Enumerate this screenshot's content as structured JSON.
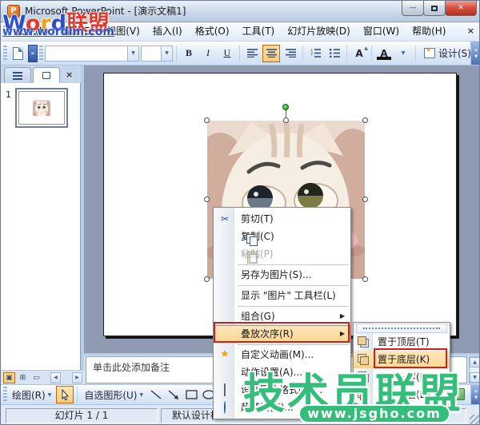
{
  "title_bar": {
    "title": "Microsoft PowerPoint - [演示文稿1]",
    "app_icon_letter": "P"
  },
  "menu_bar": {
    "items": [
      "文件(F)",
      "编辑(E)",
      "视图(V)",
      "插入(I)",
      "格式(O)",
      "工具(T)",
      "幻灯片放映(D)",
      "窗口(W)",
      "帮助(H)"
    ]
  },
  "format_toolbar": {
    "font_name_value": "",
    "font_size_value": "",
    "bold": "B",
    "italic": "I",
    "underline": "U",
    "grow_font": "A",
    "font_color": "A",
    "design": "设计(S)"
  },
  "slides_pane": {
    "slide_number": "1"
  },
  "context_menu": {
    "items": [
      {
        "id": "cut",
        "label": "剪切(T)"
      },
      {
        "id": "copy",
        "label": "复制(C)"
      },
      {
        "id": "paste",
        "label": "粘贴(P)",
        "disabled": true
      },
      {
        "id": "save-as-picture",
        "label": "另存为图片(S)..."
      },
      {
        "id": "show-picture-toolbar",
        "label": "显示 \"图片\" 工具栏(L)"
      },
      {
        "id": "group",
        "label": "组合(G)",
        "has_submenu": true
      },
      {
        "id": "order",
        "label": "叠放次序(R)",
        "has_submenu": true,
        "highlighted": true
      },
      {
        "id": "custom-animation",
        "label": "自定义动画(M)..."
      },
      {
        "id": "action-settings",
        "label": "动作设置(A)..."
      },
      {
        "id": "format-picture",
        "label": "设置图片格式(O)..."
      },
      {
        "id": "hyperlink",
        "label": "超链接(H)..."
      }
    ]
  },
  "order_submenu": {
    "items": [
      {
        "id": "bring-to-front",
        "label": "置于顶层(T)"
      },
      {
        "id": "send-to-back",
        "label": "置于底层(K)",
        "highlighted": true
      },
      {
        "id": "bring-forward",
        "label": "上移一层(F)"
      },
      {
        "id": "send-backward",
        "label": "下移一层(B)"
      }
    ]
  },
  "notes": {
    "placeholder": "单击此处添加备注"
  },
  "drawing_toolbar": {
    "draw": "绘图(R)",
    "autoshapes": "自选图形(U)"
  },
  "status_bar": {
    "slide_indicator": "幻灯片 1 / 1",
    "design_template": "默认设计模板"
  },
  "watermarks": {
    "top": {
      "letters": [
        "W",
        "o",
        "r",
        "d",
        "联盟"
      ],
      "url": "www.wordlm.com"
    },
    "bottom": {
      "brand": "技术员联盟",
      "url": "www.jsgho.com"
    }
  },
  "icons": {
    "minimize": "—",
    "close": "✕",
    "menubar_close": "×",
    "dropdown": "▼",
    "overflow": "»",
    "submenu_arrow": "▶",
    "scissors": "✂",
    "star": "★",
    "up_arrow": "▲",
    "down_arrow": "▼",
    "left_arrow": "◀",
    "right_arrow": "▶",
    "normal_view": "▣",
    "sorter_view": "⊞",
    "show_view": "▭"
  },
  "colors": {
    "highlight_orange": "#fbce82",
    "highlight_border": "#c96306",
    "annotation_red": "#d41d1d",
    "watermark_green": "#35bd7b",
    "watermark_blue": "#2e4fc4",
    "watermark_red": "#e23a2e",
    "workspace_gray": "#8f9ab3"
  }
}
